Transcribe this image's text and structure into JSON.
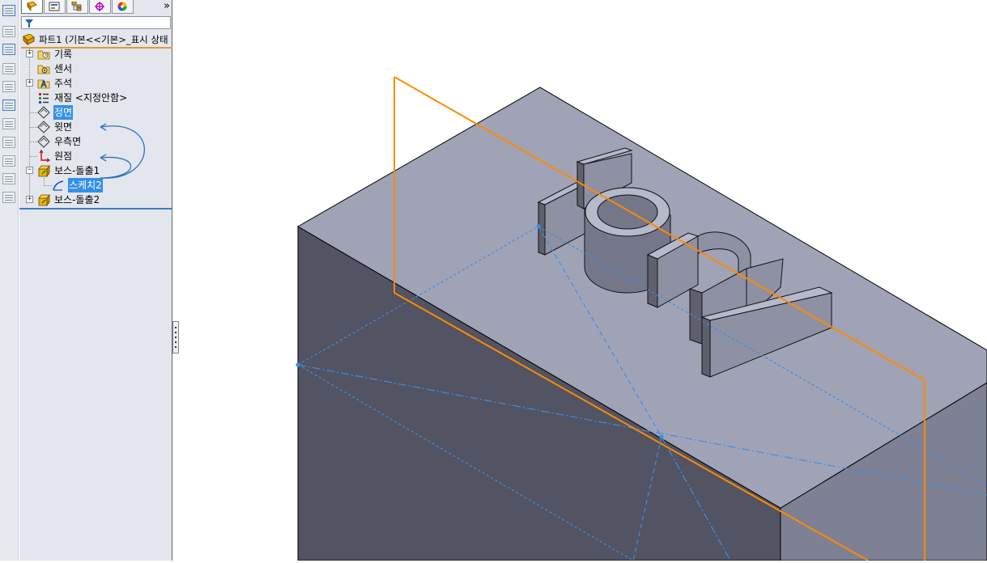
{
  "tabs": [
    {
      "id": "feature-manager",
      "icon": "feature-tree-icon",
      "active": true
    },
    {
      "id": "property-manager",
      "icon": "property-manager-icon",
      "active": false
    },
    {
      "id": "configuration-manager",
      "icon": "configuration-manager-icon",
      "active": false
    },
    {
      "id": "dimxpert-manager",
      "icon": "dimxpert-icon",
      "active": false
    },
    {
      "id": "display-manager",
      "icon": "appearance-wheel-icon",
      "active": false
    }
  ],
  "tabs_more": "»",
  "part": {
    "label": "파트1  (기본<<기본>_표시 상태"
  },
  "tree": {
    "items": [
      {
        "label": "기록",
        "icon": "history-folder-icon"
      },
      {
        "label": "센서",
        "icon": "sensor-folder-icon"
      },
      {
        "label": "주석",
        "icon": "annotations-folder-icon"
      },
      {
        "label": "재질 <지정안함>",
        "icon": "material-icon"
      },
      {
        "label": "정면",
        "icon": "plane-icon"
      },
      {
        "label": "윗면",
        "icon": "plane-icon"
      },
      {
        "label": "우측면",
        "icon": "plane-icon"
      },
      {
        "label": "원점",
        "icon": "origin-icon"
      },
      {
        "label": "보스-돌출1",
        "icon": "boss-extrude-icon"
      },
      {
        "label": "스케치2",
        "icon": "sketch-icon"
      },
      {
        "label": "보스-돌출2",
        "icon": "boss-extrude-icon"
      }
    ]
  },
  "colors": {
    "plane_highlight": "#ff8a00",
    "sketch_blue": "#3d8fe0",
    "top_face": "#a0a3b6",
    "front_face": "#525363",
    "right_face": "#7e8094",
    "selection": "#3390ea"
  },
  "viewport": {
    "emboss_text": "tory"
  }
}
